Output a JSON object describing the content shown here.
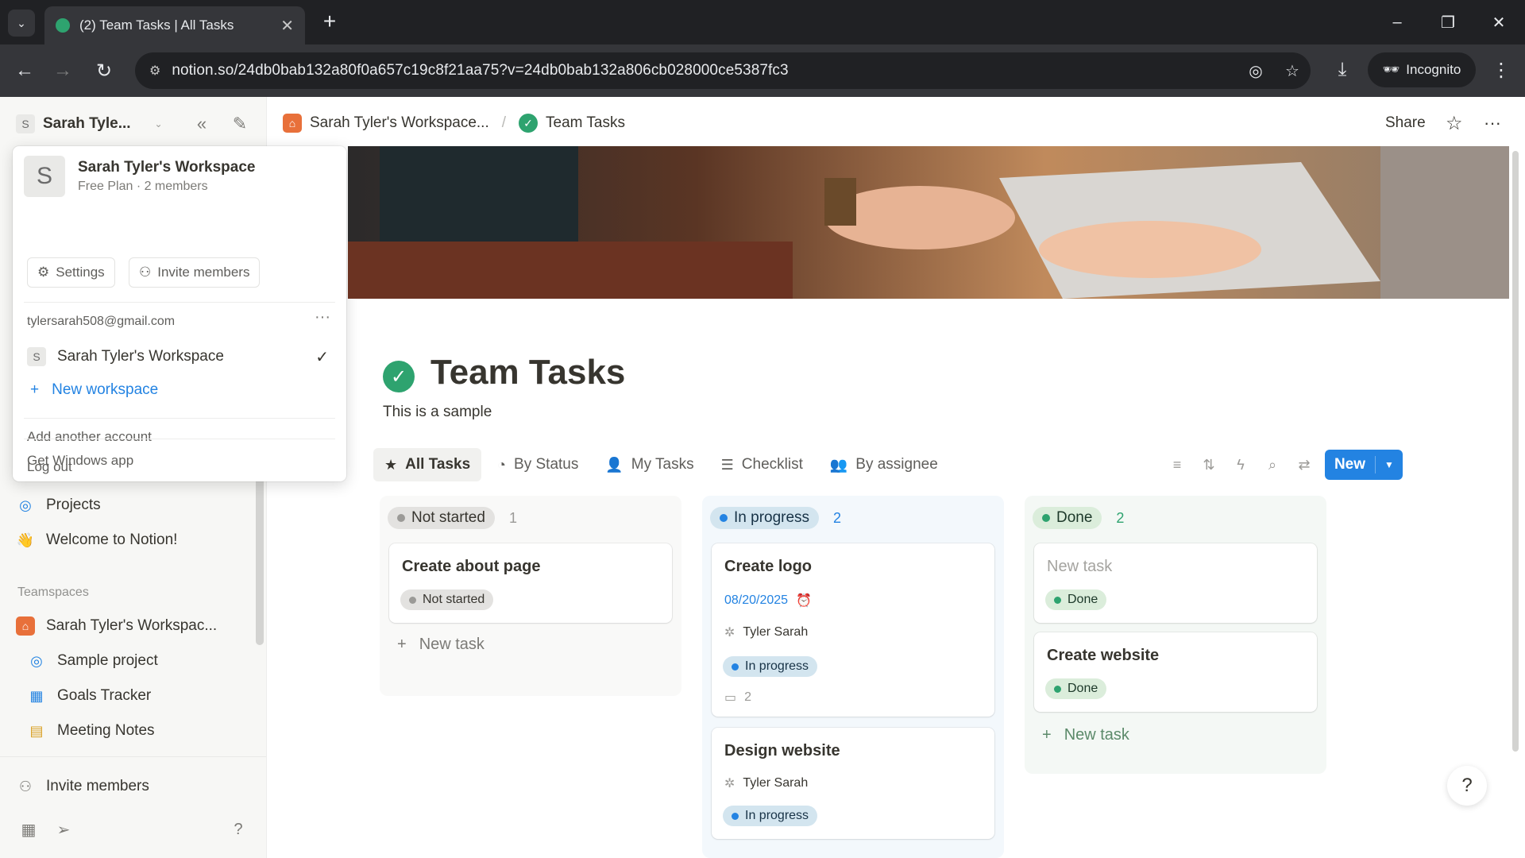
{
  "browser": {
    "tab_title": "(2) Team Tasks | All Tasks",
    "url": "notion.so/24db0bab132a80f0a657c19c8f21aa75?v=24db0bab132a806cb028000ce5387fc3",
    "incognito_label": "Incognito"
  },
  "sidebar": {
    "workspace_switcher": "Sarah Tyle...",
    "avatar_letter": "S",
    "items": [
      {
        "label": "Projects"
      },
      {
        "label": "Welcome to Notion!"
      }
    ],
    "teamspaces_heading": "Teamspaces",
    "teamspace": "Sarah Tyler's Workspac...",
    "teamspace_pages": [
      {
        "label": "Sample project"
      },
      {
        "label": "Goals Tracker"
      },
      {
        "label": "Meeting Notes"
      }
    ],
    "invite": "Invite members"
  },
  "dropdown": {
    "workspace_name": "Sarah Tyler's Workspace",
    "plan": "Free Plan · 2 members",
    "settings": "Settings",
    "invite": "Invite members",
    "email": "tylersarah508@gmail.com",
    "workspace_entry": "Sarah Tyler's Workspace",
    "new_workspace": "New workspace",
    "add_account": "Add another account",
    "logout": "Log out",
    "get_app": "Get Windows app"
  },
  "header": {
    "breadcrumb_workspace": "Sarah Tyler's Workspace...",
    "breadcrumb_page": "Team Tasks",
    "share": "Share"
  },
  "page": {
    "title": "Team Tasks",
    "description": "This is a sample"
  },
  "views": [
    {
      "label": "All Tasks",
      "icon": "star-icon"
    },
    {
      "label": "By Status",
      "icon": "status-icon"
    },
    {
      "label": "My Tasks",
      "icon": "person-icon"
    },
    {
      "label": "Checklist",
      "icon": "checklist-icon"
    },
    {
      "label": "By assignee",
      "icon": "people-icon"
    }
  ],
  "new_button": "New",
  "board": {
    "columns": [
      {
        "status": "Not started",
        "count": "1",
        "color": "#9b9a97",
        "bg": "#f1f1ef",
        "pill_bg": "#e3e2e0"
      },
      {
        "status": "In progress",
        "count": "2",
        "color": "#2383e2",
        "bg": "#f3f8fc",
        "pill_bg": "#d3e5ef"
      },
      {
        "status": "Done",
        "count": "2",
        "color": "#2ea36f",
        "bg": "#f4f8f5",
        "pill_bg": "#dbeddb"
      }
    ],
    "cards": {
      "c1": {
        "title": "Create about page",
        "status": "Not started"
      },
      "c2": {
        "title": "Create logo",
        "date": "08/20/2025",
        "assignee": "Tyler Sarah",
        "status": "In progress",
        "comments": "2"
      },
      "c3": {
        "title": "Design website",
        "assignee": "Tyler Sarah",
        "status": "In progress"
      },
      "c4": {
        "title": "New task",
        "status": "Done"
      },
      "c5": {
        "title": "Create website",
        "status": "Done"
      }
    },
    "add_label": "New task"
  }
}
